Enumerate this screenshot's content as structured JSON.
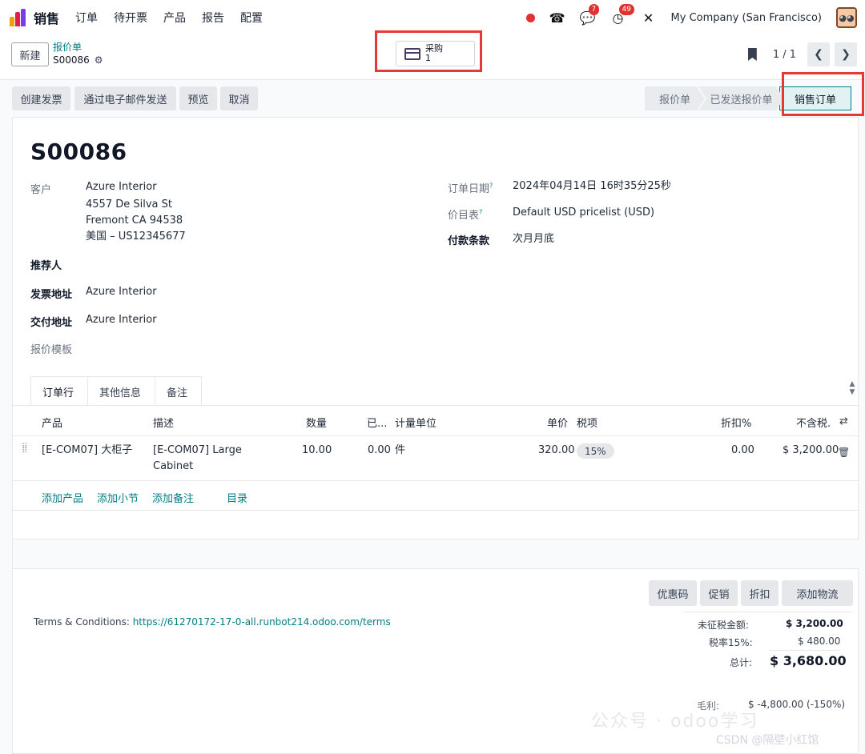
{
  "navbar": {
    "app_name": "销售",
    "menu": [
      "订单",
      "待开票",
      "产品",
      "报告",
      "配置"
    ],
    "chat_badge": "7",
    "activity_badge": "49",
    "company": "My Company (San Francisco)"
  },
  "control": {
    "new_button": "新建",
    "breadcrumb_parent": "报价单",
    "breadcrumb_current": "S00086",
    "smart_button_label": "采购",
    "smart_button_count": "1",
    "pager_value": "1 / 1"
  },
  "actions": {
    "create_invoice": "创建发票",
    "send_email": "通过电子邮件发送",
    "preview": "预览",
    "cancel": "取消"
  },
  "stages": [
    "报价单",
    "已发送报价单",
    "销售订单"
  ],
  "form": {
    "title": "S00086",
    "customer_label": "客户",
    "customer_name": "Azure Interior",
    "customer_addr1": "4557 De Silva St",
    "customer_addr2": "Fremont CA 94538",
    "customer_addr3": "美国 – US12345677",
    "referrer_label": "推荐人",
    "invoice_addr_label": "发票地址",
    "invoice_addr": "Azure Interior",
    "delivery_addr_label": "交付地址",
    "delivery_addr": "Azure Interior",
    "template_label": "报价模板",
    "order_date_label": "订单日期",
    "order_date": "2024年04月14日 16时35分25秒",
    "pricelist_label": "价目表",
    "pricelist": "Default USD pricelist (USD)",
    "payment_terms_label": "付款条款",
    "payment_terms": "次月月底",
    "help_mark": "?"
  },
  "tabs": [
    "订单行",
    "其他信息",
    "备注"
  ],
  "table": {
    "headers": {
      "product": "产品",
      "description": "描述",
      "quantity": "数量",
      "delivered": "已...",
      "uom": "计量单位",
      "unit_price": "单价",
      "taxes": "税项",
      "discount": "折扣%",
      "subtotal": "不含税."
    },
    "rows": [
      {
        "product": "[E-COM07] 大柜子",
        "desc1": "[E-COM07] Large",
        "desc2": "Cabinet",
        "quantity": "10.00",
        "delivered": "0.00",
        "uom": "件",
        "unit_price": "320.00",
        "tax": "15%",
        "discount": "0.00",
        "subtotal": "$ 3,200.00"
      }
    ],
    "add_links": [
      "添加产品",
      "添加小节",
      "添加备注",
      "目录"
    ]
  },
  "promo_buttons": [
    "优惠码",
    "促销",
    "折扣",
    "添加物流"
  ],
  "terms": {
    "label": "Terms & Conditions: ",
    "url": "https://61270172-17-0-all.runbot214.odoo.com/terms"
  },
  "totals": {
    "untaxed_label": "未征税金额:",
    "untaxed": "$ 3,200.00",
    "tax_label": "税率15%:",
    "tax": "$ 480.00",
    "total_label": "总计:",
    "total": "$ 3,680.00",
    "margin_label": "毛利:",
    "margin": "$ -4,800.00 (-150%)"
  },
  "watermark": {
    "text": "公众号 · odoo学习",
    "subtext": "CSDN @隔壁小红馆"
  },
  "colors": {
    "accent": "#017e84",
    "highlight": "#e53935"
  }
}
